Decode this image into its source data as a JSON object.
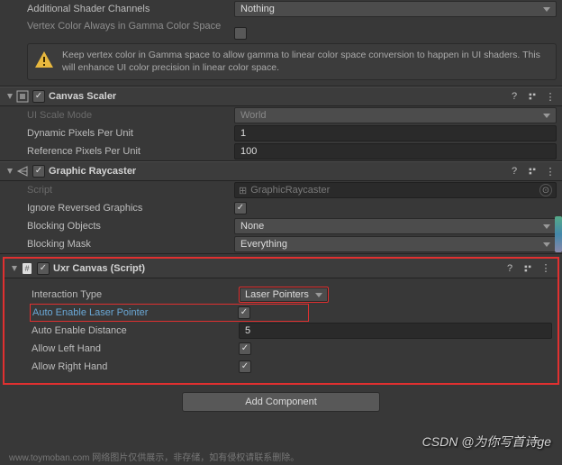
{
  "canvas": {
    "additional_shader_label": "Additional Shader Channels",
    "additional_shader_value": "Nothing",
    "vertex_gamma_label": "Vertex Color Always in Gamma Color Space",
    "help_text": "Keep vertex color in Gamma space to allow gamma to linear color space conversion to happen in UI shaders. This will enhance UI color precision in linear color space."
  },
  "scaler": {
    "title": "Canvas Scaler",
    "ui_scale_mode_label": "UI Scale Mode",
    "ui_scale_mode_value": "World",
    "dynamic_pixels_label": "Dynamic Pixels Per Unit",
    "dynamic_pixels_value": "1",
    "reference_pixels_label": "Reference Pixels Per Unit",
    "reference_pixels_value": "100"
  },
  "raycaster": {
    "title": "Graphic Raycaster",
    "script_label": "Script",
    "script_value": "GraphicRaycaster",
    "ignore_reversed_label": "Ignore Reversed Graphics",
    "blocking_objects_label": "Blocking Objects",
    "blocking_objects_value": "None",
    "blocking_mask_label": "Blocking Mask",
    "blocking_mask_value": "Everything"
  },
  "uxr": {
    "title": "Uxr Canvas (Script)",
    "interaction_type_label": "Interaction Type",
    "interaction_type_value": "Laser Pointers",
    "auto_enable_laser_label": "Auto Enable Laser Pointer",
    "auto_enable_distance_label": "Auto Enable Distance",
    "auto_enable_distance_value": "5",
    "allow_left_label": "Allow Left Hand",
    "allow_right_label": "Allow Right Hand"
  },
  "add_component_label": "Add Component",
  "watermark": "CSDN @为你写首诗ge",
  "footer": "www.toymoban.com  网络图片仅供展示，非存储，如有侵权请联系删除。"
}
